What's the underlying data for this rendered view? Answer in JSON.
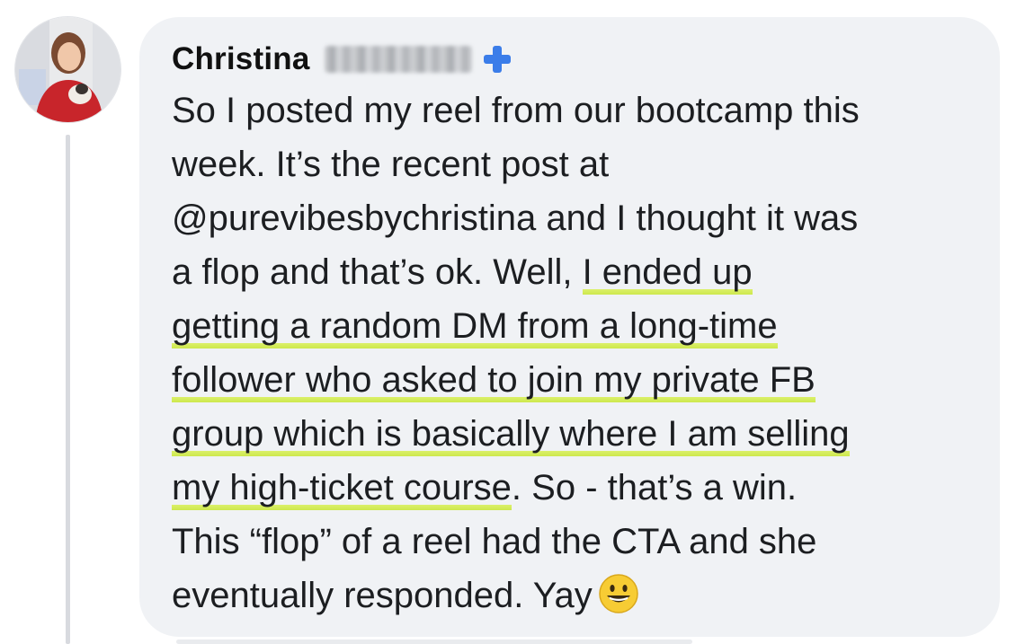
{
  "comment": {
    "author_name": "Christina",
    "lines": [
      {
        "parts": [
          {
            "text": "So I posted my reel from our bootcamp this",
            "highlight": false
          }
        ]
      },
      {
        "parts": [
          {
            "text": "week. It’s the recent post at",
            "highlight": false
          }
        ]
      },
      {
        "parts": [
          {
            "text": "@purevibesbychristina and I thought it was",
            "highlight": false
          }
        ]
      },
      {
        "parts": [
          {
            "text": "a flop and that’s ok. Well, ",
            "highlight": false
          },
          {
            "text": "I ended up",
            "highlight": true
          }
        ]
      },
      {
        "parts": [
          {
            "text": "getting a random DM from a long-time",
            "highlight": true
          }
        ]
      },
      {
        "parts": [
          {
            "text": "follower who asked to join my private FB",
            "highlight": true
          }
        ]
      },
      {
        "parts": [
          {
            "text": "group which is basically where I am selling",
            "highlight": true
          }
        ]
      },
      {
        "parts": [
          {
            "text": "my high-ticket course",
            "highlight": true
          },
          {
            "text": ". So - that’s a win.",
            "highlight": false
          }
        ]
      },
      {
        "parts": [
          {
            "text": "This “flop” of a reel had the CTA and she",
            "highlight": false
          }
        ]
      },
      {
        "parts": [
          {
            "text": "eventually responded. Yay",
            "highlight": false
          }
        ]
      }
    ],
    "trailing_emoji": "grinning-face-icon",
    "badge_icon": "plus-badge-icon"
  },
  "colors": {
    "bubble_background": "#f0f2f5",
    "highlight": "#d4ec5a",
    "badge": "#3b7de9",
    "text": "#1c1e21"
  }
}
